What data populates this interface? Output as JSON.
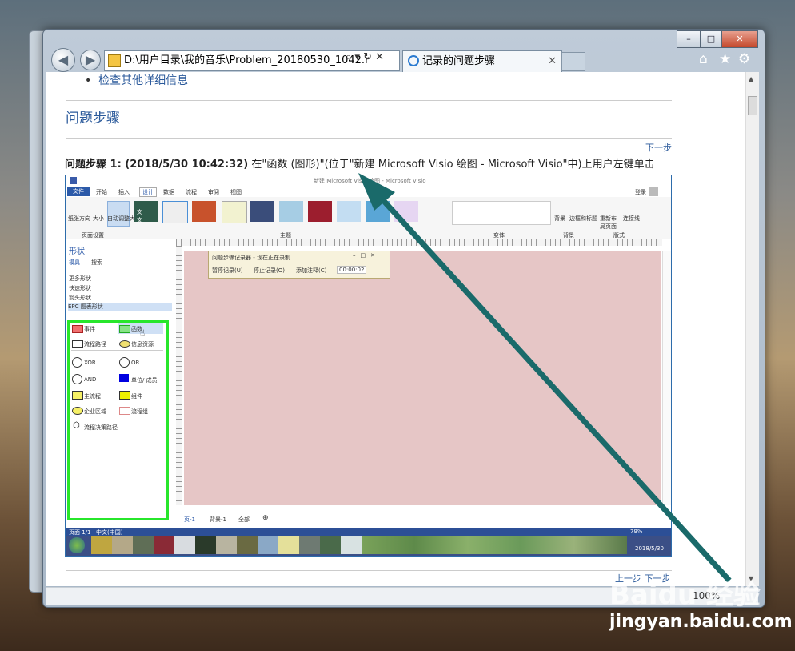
{
  "window": {
    "address": "D:\\用户目录\\我的音乐\\Problem_20180530_1042.r",
    "tab_title": "记录的问题步骤",
    "caption": {
      "min": "–",
      "max": "□",
      "close": "✕"
    },
    "nav_icons": {
      "home": "⌂",
      "star": "★",
      "gear": "⚙"
    },
    "addr_icons": "⌕ ▾ ↻ ✕",
    "zoom": "100%"
  },
  "page": {
    "bullet_link": "检查其他详细信息",
    "section_title": "问题步骤",
    "next_step": "下一步",
    "step_heading": "问题步骤 1: (2018/5/30 10:42:32)",
    "step_desc": " 在\"函数 (图形)\"(位于\"新建 Microsoft Visio 绘图 - Microsoft Visio\"中)上用户左键单击",
    "prev_step": "上一步",
    "next_step2": "下一步"
  },
  "visio": {
    "title": "新建 Microsoft Visio 绘图 - Microsoft Visio",
    "ribbon_tabs": [
      "文件",
      "开始",
      "插入",
      "设计",
      "数据",
      "流程",
      "审阅",
      "视图"
    ],
    "page_setup": [
      "纸张方向",
      "大小",
      "自动调整大小"
    ],
    "group_labels": [
      "页面设置",
      "主题",
      "变体",
      "背景",
      "版式"
    ],
    "theme_text": "文文",
    "right_buttons": [
      "背景",
      "边框和标题",
      "重新布局页面",
      "连接线"
    ],
    "user": "登录",
    "shapes_title": "形状",
    "shapes_tabs": [
      "模具",
      "搜索"
    ],
    "stencil_list": [
      "更多形状",
      "快速形状",
      "箭头形状",
      "EPC 图表形状"
    ],
    "shapes": [
      "事件",
      "函数",
      "流程路径",
      "信息资源",
      "XOR",
      "OR",
      "AND",
      "单位/ 成员",
      "主流程",
      "组件",
      "企业区域",
      "流程组",
      "流程决策路径"
    ],
    "recorder_title": "问题步骤记录器 - 现在正在录制",
    "recorder_buttons": [
      "暂停记录(U)",
      "停止记录(O)",
      "添加注释(C)"
    ],
    "recorder_time": "00:00:02",
    "page_tabs": [
      "页-1",
      "背景-1",
      "全部"
    ],
    "statusbar_left": [
      "页面 1/1",
      "中文(中国)"
    ],
    "zoom": "79%",
    "clock": "2018/5/30"
  },
  "watermark": {
    "brand": "Baidu 经验",
    "url": "jingyan.baidu.com"
  },
  "colors": {
    "canvas": "#e6c6c6",
    "taskbar": "#3b4f86",
    "highlight_box": "#27e62b",
    "arrow": "#1a6a6a",
    "link": "#2b5a9b"
  }
}
